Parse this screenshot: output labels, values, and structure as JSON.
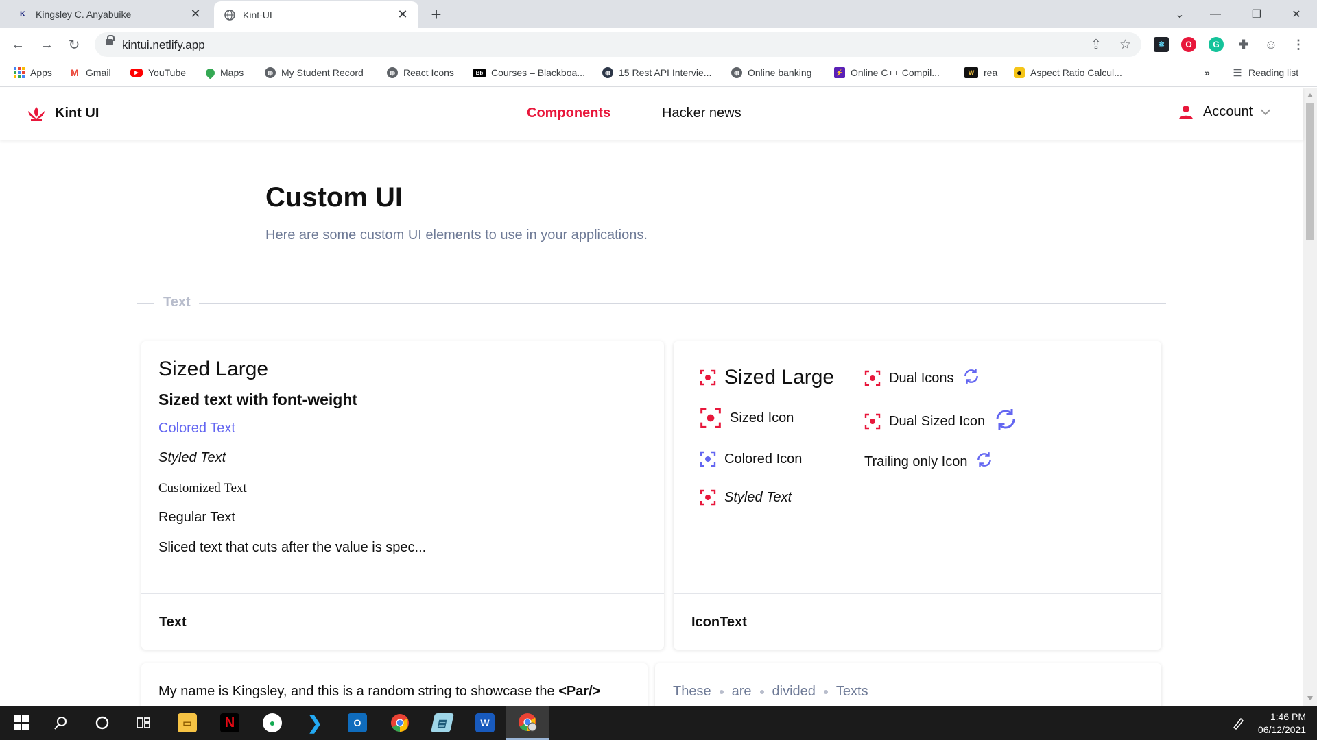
{
  "browser": {
    "tabs": [
      {
        "title": "Kingsley C. Anyabuike",
        "favicon": "K"
      },
      {
        "title": "Kint-UI"
      }
    ],
    "url": "kintui.netlify.app",
    "bookmarks": [
      {
        "label": "Apps",
        "icon": "apps-grid-icon"
      },
      {
        "label": "Gmail",
        "icon": "gmail-icon"
      },
      {
        "label": "YouTube",
        "icon": "youtube-icon"
      },
      {
        "label": "Maps",
        "icon": "maps-icon"
      },
      {
        "label": "My Student Record",
        "icon": "globe-icon"
      },
      {
        "label": "React Icons",
        "icon": "globe-icon"
      },
      {
        "label": "Courses – Blackboa...",
        "icon": "blackboard-icon",
        "favicon": "Bb"
      },
      {
        "label": "15 Rest API Intervie...",
        "icon": "globe-dark-icon"
      },
      {
        "label": "Online banking",
        "icon": "globe-icon"
      },
      {
        "label": "Online C++ Compil...",
        "icon": "bolt-icon"
      },
      {
        "label": "rea",
        "icon": "w-icon",
        "favicon": "W"
      },
      {
        "label": "Aspect Ratio Calcul...",
        "icon": "aspect-ratio-icon"
      }
    ],
    "overflow_label": "»",
    "reading_list": "Reading list"
  },
  "app": {
    "brand": "Kint UI",
    "nav": {
      "components": "Components",
      "hacker_news": "Hacker news"
    },
    "account": "Account",
    "accent": "#e8173b",
    "indigo": "#6366f1"
  },
  "page": {
    "title": "Custom UI",
    "subtitle": "Here are some custom UI elements to use in your applications.",
    "section": "Text"
  },
  "text_card": {
    "sized_large": "Sized Large",
    "bold": "Sized text with font-weight",
    "colored": "Colored Text",
    "styled": "Styled Text",
    "customized": "Customized Text",
    "regular": "Regular Text",
    "sliced": "Sliced text that cuts after the value is spec...",
    "footer": "Text"
  },
  "icontext_card": {
    "sized_large": "Sized Large",
    "sized_icon": "Sized Icon",
    "colored_icon": "Colored Icon",
    "styled_text": "Styled Text",
    "dual_icons": "Dual Icons",
    "dual_sized_icon": "Dual Sized Icon",
    "trailing_only": "Trailing only Icon",
    "footer": "IconText"
  },
  "par_card": {
    "text": "My name is Kingsley, and this is a random string to showcase the ",
    "tag": "<Par/>"
  },
  "divided_card": {
    "words": [
      "These",
      "are",
      "divided",
      "Texts"
    ]
  },
  "taskbar": {
    "time": "1:46 PM",
    "date": "06/12/2021"
  }
}
